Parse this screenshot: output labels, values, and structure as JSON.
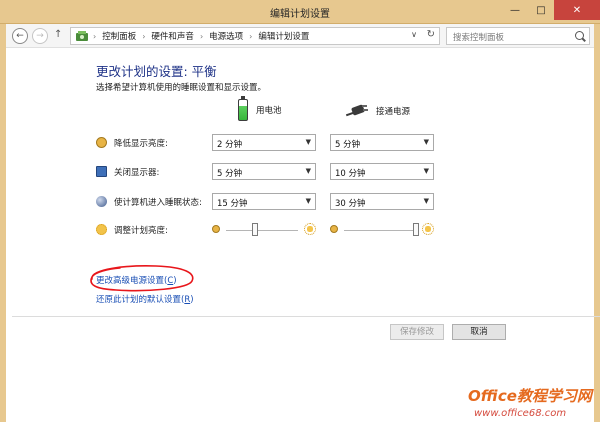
{
  "window": {
    "title": "编辑计划设置",
    "min_glyph": "—",
    "max_glyph": "□",
    "close_glyph": "✕"
  },
  "nav": {
    "back_glyph": "←",
    "forward_glyph": "→",
    "up_glyph": "↑",
    "breadcrumbs": [
      "控制面板",
      "硬件和声音",
      "电源选项",
      "编辑计划设置"
    ],
    "separator": "›",
    "dropdown_glyph": "∨",
    "refresh_glyph": "↻",
    "search_placeholder": "搜索控制面板"
  },
  "page": {
    "heading": "更改计划的设置: 平衡",
    "subtitle": "选择希望计算机使用的睡眠设置和显示设置。"
  },
  "columns": {
    "battery": "用电池",
    "plugged": "接通电源"
  },
  "settings": [
    {
      "label": "降低显示亮度:",
      "icon": "dim-display-icon",
      "battery": "2 分钟",
      "plugged": "5 分钟"
    },
    {
      "label": "关闭显示器:",
      "icon": "monitor-icon",
      "battery": "5 分钟",
      "plugged": "10 分钟"
    },
    {
      "label": "使计算机进入睡眠状态:",
      "icon": "sleep-icon",
      "battery": "15 分钟",
      "plugged": "30 分钟"
    }
  ],
  "brightness": {
    "label": "调整计划亮度:",
    "battery_level": 0.4,
    "plugged_level": 1.0
  },
  "links": {
    "advanced_text": "更改高级电源设置(",
    "advanced_key": "C",
    "advanced_close": ")",
    "restore_text": "还原此计划的默认设置(",
    "restore_key": "R",
    "restore_close": ")"
  },
  "buttons": {
    "save": "保存修改",
    "cancel": "取消"
  },
  "watermark": {
    "line1": "Office教程学习网",
    "line2": "www.office68.com"
  },
  "colors": {
    "titlebar": "#e7c88f",
    "heading": "#1e3287",
    "link": "#1a4fb5",
    "annotation": "#e8161b",
    "close_button": "#c7443d"
  }
}
